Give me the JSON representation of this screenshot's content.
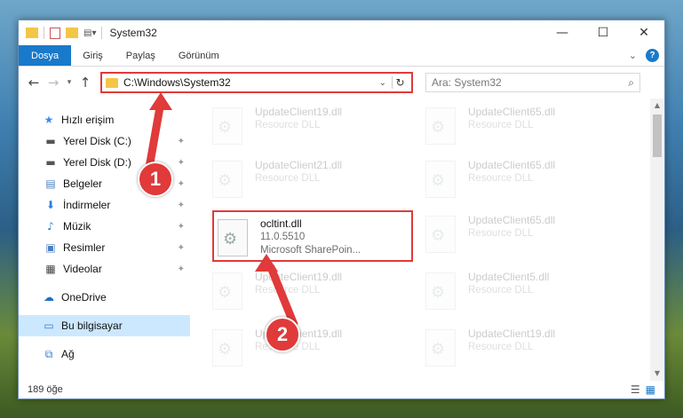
{
  "window": {
    "title": "System32",
    "controls": {
      "minimize": "—",
      "maximize": "☐",
      "close": "✕"
    }
  },
  "ribbon": {
    "tabs": [
      "Dosya",
      "Giriş",
      "Paylaş",
      "Görünüm"
    ],
    "expand": "⌄",
    "help": "?"
  },
  "address": {
    "back": "←",
    "forward": "→",
    "recent": "▾",
    "up": "↑",
    "path": "C:\\Windows\\System32",
    "dropdown": "⌄",
    "refresh": "↻",
    "search_placeholder": "Ara: System32",
    "search_icon": "⌕"
  },
  "nav": {
    "items": [
      {
        "label": "Hızlı erişim",
        "icon": "star-icon",
        "glyph": "★",
        "pinned": false
      },
      {
        "label": "Yerel Disk (C:)",
        "icon": "drive-icon",
        "glyph": "▬",
        "pinned": true
      },
      {
        "label": "Yerel Disk (D:)",
        "icon": "drive-icon",
        "glyph": "▬",
        "pinned": true
      },
      {
        "label": "Belgeler",
        "icon": "documents-icon",
        "glyph": "▤",
        "pinned": true
      },
      {
        "label": "İndirmeler",
        "icon": "download-icon",
        "glyph": "⬇",
        "pinned": true
      },
      {
        "label": "Müzik",
        "icon": "music-icon",
        "glyph": "♪",
        "pinned": true
      },
      {
        "label": "Resimler",
        "icon": "pictures-icon",
        "glyph": "▣",
        "pinned": true
      },
      {
        "label": "Videolar",
        "icon": "video-icon",
        "glyph": "▦",
        "pinned": true
      },
      {
        "label": "OneDrive",
        "icon": "cloud-icon",
        "glyph": "☁",
        "pinned": false
      },
      {
        "label": "Bu bilgisayar",
        "icon": "computer-icon",
        "glyph": "▭",
        "pinned": false
      },
      {
        "label": "Ağ",
        "icon": "network-icon",
        "glyph": "⧉",
        "pinned": false
      }
    ],
    "pin_glyph": "✦"
  },
  "files": [
    {
      "name": "UpdateClient19.dll",
      "desc": "Resource DLL",
      "faded": true
    },
    {
      "name": "UpdateClient65.dll",
      "desc": "Resource DLL",
      "faded": true
    },
    {
      "name": "UpdateClient21.dll",
      "desc": "Resource DLL",
      "faded": true
    },
    {
      "name": "UpdateClient65.dll",
      "desc": "Resource DLL",
      "faded": true
    },
    {
      "name": "ocltint.dll",
      "desc": "11.0.5510",
      "desc2": "Microsoft SharePoin...",
      "faded": false
    },
    {
      "name": "UpdateClient65.dll",
      "desc": "Resource DLL",
      "faded": true
    },
    {
      "name": "UpdateClient19.dll",
      "desc": "Resource DLL",
      "faded": true
    },
    {
      "name": "UpdateClient5.dll",
      "desc": "Resource DLL",
      "faded": true
    },
    {
      "name": "UpdateClient19.dll",
      "desc": "Resource DLL",
      "faded": true
    },
    {
      "name": "UpdateClient19.dll",
      "desc": "Resource DLL",
      "faded": true
    }
  ],
  "status": {
    "count": "189 öğe"
  },
  "annotations": {
    "step1": "1",
    "step2": "2"
  },
  "colors": {
    "accent": "#1979ca",
    "highlight": "#e03a3a",
    "selected": "#cce8ff"
  }
}
